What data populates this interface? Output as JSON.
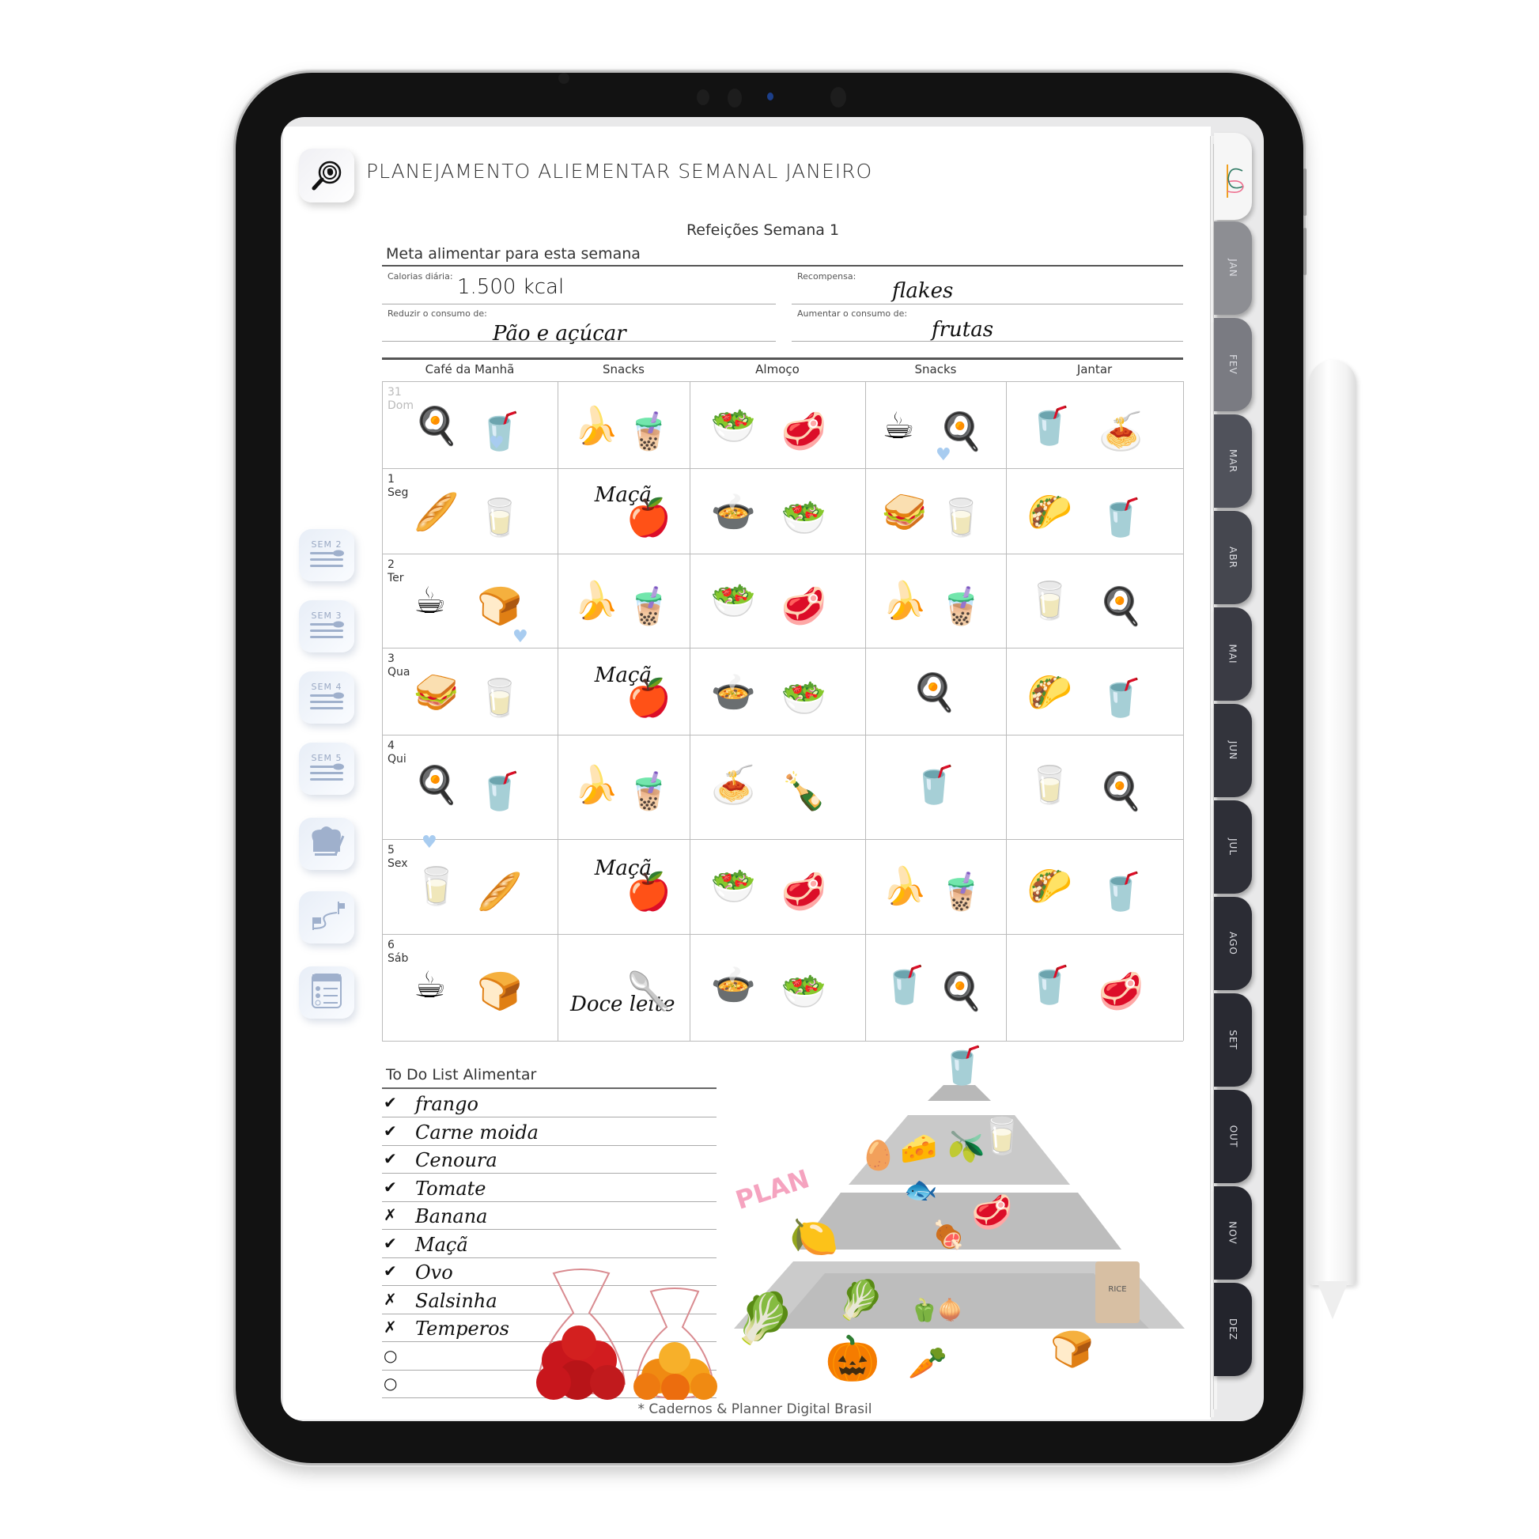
{
  "app": {
    "title": "PLANEJAMENTO ALIEMENTAR SEMANAL JANEIRO",
    "title_icon": "magnifier-icon"
  },
  "week": {
    "title": "Refeições Semana 1"
  },
  "meta": {
    "heading": "Meta alimentar para esta semana",
    "fields": [
      {
        "label": "Calorias diária:",
        "value": "1.500 kcal"
      },
      {
        "label": "Recompensa:",
        "value": "flakes"
      },
      {
        "label": "Reduzir o consumo de:",
        "value": "Pão e açúcar"
      },
      {
        "label": "Aumentar o consumo de:",
        "value": "frutas"
      }
    ]
  },
  "table": {
    "columns": [
      "Café da Manhã",
      "Snacks",
      "Almoço",
      "Snacks",
      "Jantar"
    ],
    "rows": [
      {
        "day_num": "31",
        "day_name": "Dom",
        "faded": true,
        "cells": [
          [
            "🍳",
            "🥤"
          ],
          [
            "🍌",
            "🧋"
          ],
          [
            "🥗",
            "🥩"
          ],
          [
            "☕",
            "🍳"
          ],
          [
            "🥤",
            "🍝"
          ]
        ]
      },
      {
        "day_num": "1",
        "day_name": "Seg",
        "cells": [
          [
            "🥖",
            "🥛"
          ],
          [
            "Maçã",
            "🍎"
          ],
          [
            "🍲",
            "🥗"
          ],
          [
            "🥪",
            "🥛"
          ],
          [
            "🌮",
            "🥤"
          ]
        ]
      },
      {
        "day_num": "2",
        "day_name": "Ter",
        "cells": [
          [
            "☕",
            "🍞"
          ],
          [
            "🍌",
            "🧋"
          ],
          [
            "🥗",
            "🥩"
          ],
          [
            "🍌",
            "🧋"
          ],
          [
            "🥛",
            "🍳"
          ]
        ]
      },
      {
        "day_num": "3",
        "day_name": "Qua",
        "cells": [
          [
            "🥪",
            "🥛"
          ],
          [
            "Maçã",
            "🍎"
          ],
          [
            "🍲",
            "🥗"
          ],
          [
            "🍳",
            ""
          ],
          [
            "🌮",
            "🥤"
          ]
        ]
      },
      {
        "day_num": "4",
        "day_name": "Qui",
        "cells": [
          [
            "🍳",
            "🥤"
          ],
          [
            "🍌",
            "🧋"
          ],
          [
            "🍝",
            "🍾"
          ],
          [
            "🥤",
            ""
          ],
          [
            "🥛",
            "🍳"
          ]
        ]
      },
      {
        "day_num": "5",
        "day_name": "Sex",
        "cells": [
          [
            "🥛",
            "🥖"
          ],
          [
            "Maçã",
            "🍎"
          ],
          [
            "🥗",
            "🥩"
          ],
          [
            "🍌",
            "🧋"
          ],
          [
            "🌮",
            "🥤"
          ]
        ]
      },
      {
        "day_num": "6",
        "day_name": "Sáb",
        "cells": [
          [
            "☕",
            "🍞"
          ],
          [
            "Doce leite",
            "🥄"
          ],
          [
            "🍲",
            "🥗"
          ],
          [
            "🥤",
            "🍳"
          ],
          [
            "🥤",
            "🥩"
          ]
        ]
      }
    ]
  },
  "side_nav": [
    {
      "label": "SEM 2",
      "icon": "cutlery-icon"
    },
    {
      "label": "SEM 3",
      "icon": "cutlery-icon"
    },
    {
      "label": "SEM 4",
      "icon": "cutlery-icon"
    },
    {
      "label": "SEM 5",
      "icon": "cutlery-icon"
    },
    {
      "label": "",
      "icon": "chef-hat-icon"
    },
    {
      "label": "",
      "icon": "route-flags-icon"
    },
    {
      "label": "",
      "icon": "list-icon"
    }
  ],
  "month_tabs": [
    "JAN",
    "FEV",
    "MAR",
    "ABR",
    "MAI",
    "JUN",
    "JUL",
    "AGO",
    "SET",
    "OUT",
    "NOV",
    "DEZ"
  ],
  "todo": {
    "title": "To Do List Alimentar",
    "items": [
      {
        "text": "frango",
        "done": true
      },
      {
        "text": "Carne moida",
        "done": true
      },
      {
        "text": "Cenoura",
        "done": true
      },
      {
        "text": "Tomate",
        "done": true
      },
      {
        "text": "Banana",
        "done": false,
        "crossed": true
      },
      {
        "text": "Maçã",
        "done": true
      },
      {
        "text": "Ovo",
        "done": true
      },
      {
        "text": "Salsinha",
        "done": false,
        "crossed": true
      },
      {
        "text": "Temperos",
        "done": false,
        "crossed": true
      },
      {
        "text": "",
        "done": false
      },
      {
        "text": "",
        "done": false
      }
    ]
  },
  "pyramid": {
    "label": "PLAN"
  },
  "footer": "* Cadernos & Planner Digital Brasil",
  "colors": {
    "tab_light": "#8d8e93",
    "tab_mid": "#6f7078",
    "tab_dark": "#2a2b33",
    "heart": "#a8ccf0",
    "plan_pink": "#f5a3bf"
  }
}
